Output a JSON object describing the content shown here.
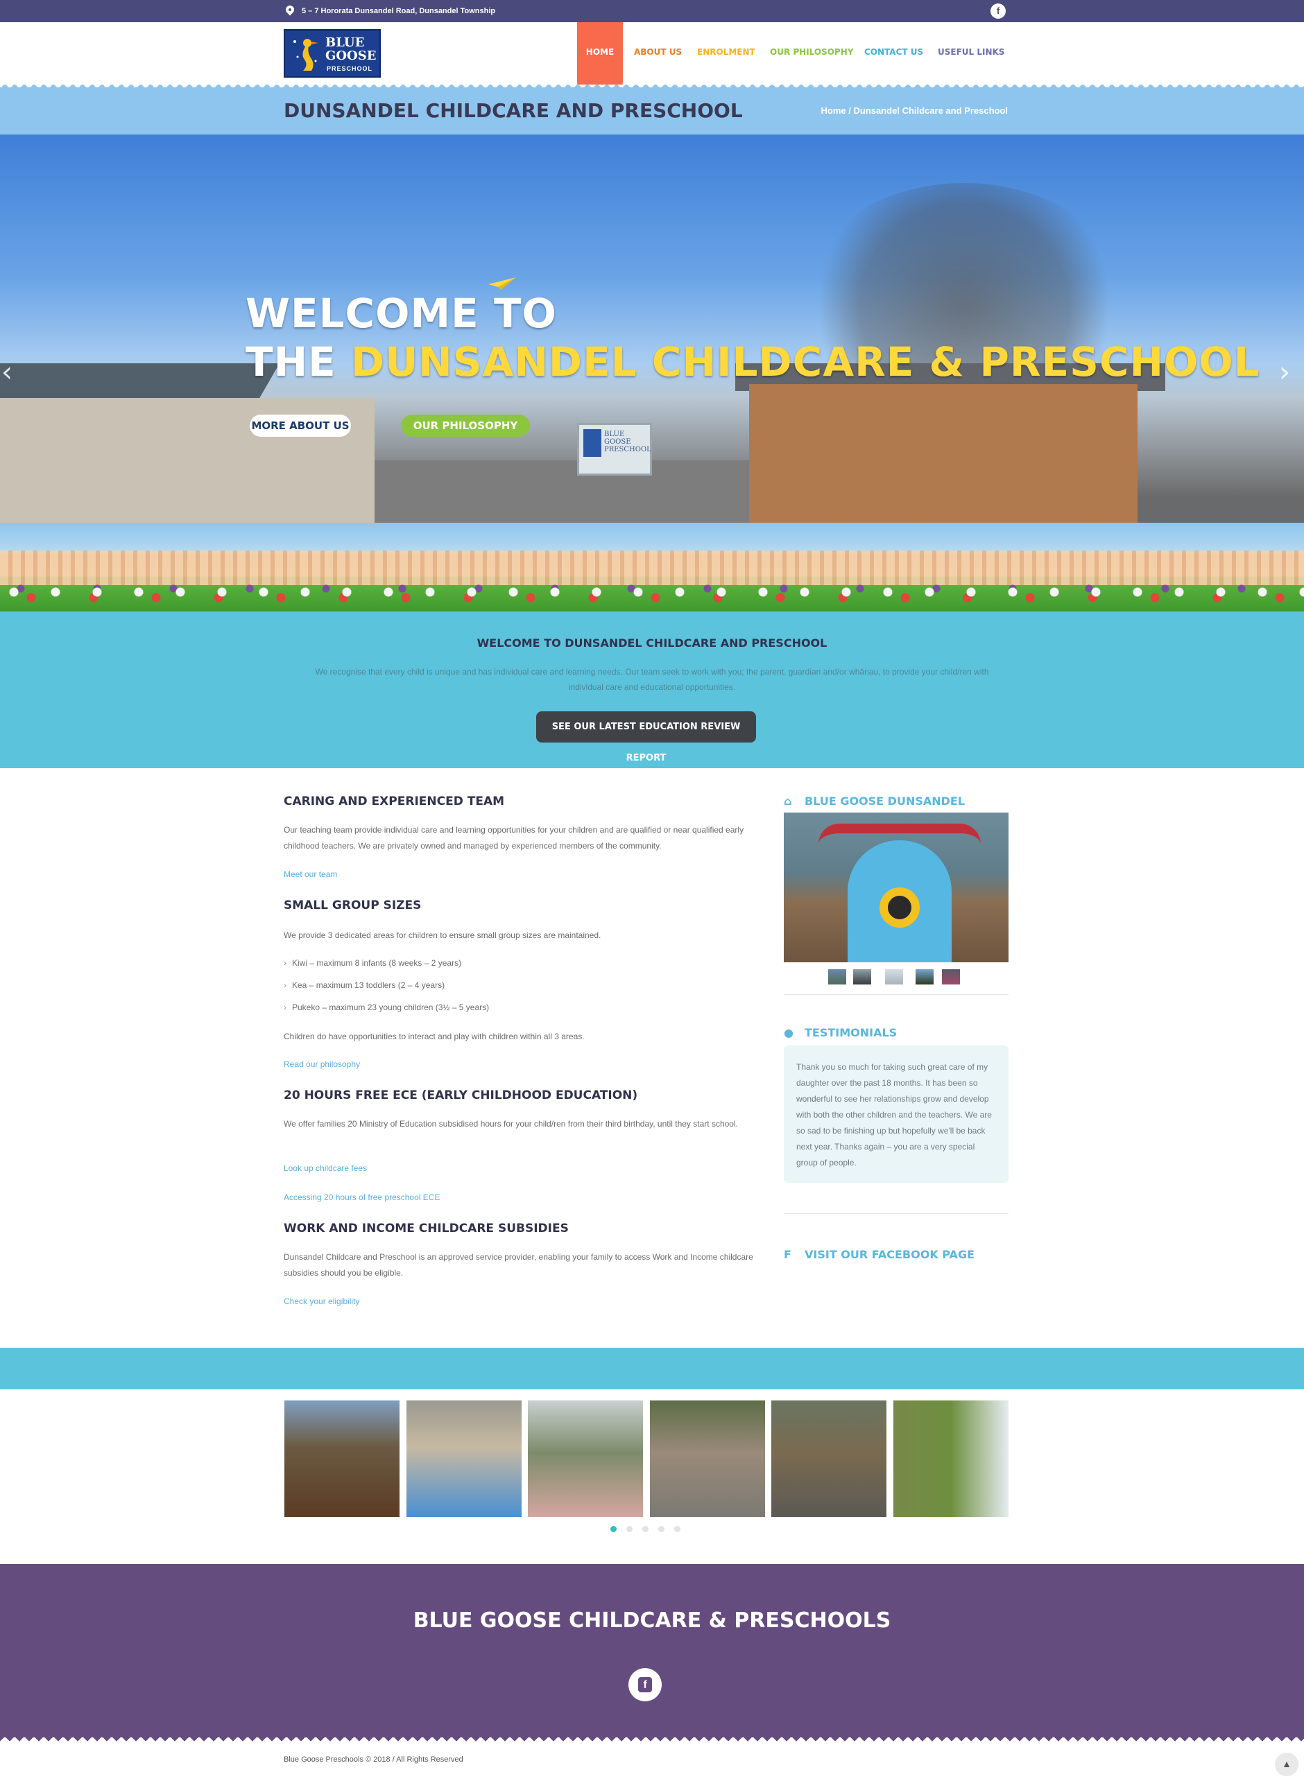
{
  "topbar": {
    "address": "5 – 7 Hororata Dunsandel Road, Dunsandel Township"
  },
  "header": {
    "logo_text": "BLUE GOOSE",
    "logo_sub": "PRESCHOOL",
    "nav": [
      {
        "label": "HOME",
        "color": "#ffffff"
      },
      {
        "label": "ABOUT US",
        "color": "#f07d1e"
      },
      {
        "label": "ENROLMENT",
        "color": "#f5b21b"
      },
      {
        "label": "OUR PHILOSOPHY",
        "color": "#8cc63e"
      },
      {
        "label": "CONTACT US",
        "color": "#3fb4d8"
      },
      {
        "label": "USEFUL LINKS",
        "color": "#6a6fb5"
      }
    ]
  },
  "titlebar": {
    "title": "DUNSANDEL CHILDCARE AND PRESCHOOL",
    "breadcrumb": "Home / Dunsandel Childcare and Preschool"
  },
  "hero": {
    "line1": "WELCOME TO",
    "line2_white": "THE",
    "line2_yellow": "DUNSANDEL CHILDCARE & PRESCHOOL",
    "btn_about": "MORE ABOUT US",
    "btn_philosophy": "OUR PHILOSOPHY",
    "sign_text": "BLUE GOOSE PRESCHOOL"
  },
  "welcome": {
    "heading": "WELCOME TO DUNSANDEL CHILDCARE AND PRESCHOOL",
    "text": "We recognise that every child is unique and has individual care and learning needs. Our team seek to work with you; the parent, guardian and/or whānau, to provide your child/ren with individual care and educational opportunities.",
    "button": "SEE OUR LATEST EDUCATION REVIEW REPORT"
  },
  "main": {
    "s1_title": "CARING AND EXPERIENCED TEAM",
    "s1_text": "Our teaching team provide individual care and learning opportunities for your children and are qualified or near qualified early childhood teachers. We are privately owned and managed by experienced members of the community.",
    "s1_link": "Meet our team",
    "s2_title": "SMALL GROUP SIZES",
    "s2_text": "We provide 3 dedicated areas for children to ensure small group sizes are maintained.",
    "s2_items": [
      "Kiwi – maximum 8 infants (8 weeks – 2 years)",
      "Kea – maximum 13 toddlers (2 – 4 years)",
      "Pukeko – maximum 23 young children (3½ – 5 years)"
    ],
    "s2_text2": "Children do have opportunities to interact and play with children within all 3 areas.",
    "s2_link": "Read our philosophy",
    "s3_title": "20 HOURS FREE ECE (EARLY CHILDHOOD EDUCATION)",
    "s3_text": "We offer families 20 Ministry of Education subsidised hours for your child/ren from their third birthday, until they start school.",
    "s3_link1": "Look up childcare fees",
    "s3_link2": "Accessing 20 hours of free preschool ECE",
    "s4_title": "WORK AND INCOME CHILDCARE SUBSIDIES",
    "s4_text": "Dunsandel Childcare and Preschool is an approved service provider, enabling your family to access Work and Income childcare subsidies should you be eligible.",
    "s4_link": "Check your eligibility"
  },
  "sidebar": {
    "gallery_title": "BLUE GOOSE DUNSANDEL",
    "testimonials_title": "TESTIMONIALS",
    "testimonial": "Thank you so much for taking such great care of my daughter over the past 18 months. It has been so wonderful to see her relationships grow and develop with both the other children and the teachers. We are so sad to be finishing up but hopefully we'll be back next year. Thanks again – you are a very special group of people.",
    "facebook_link": "VISIT OUR FACEBOOK PAGE"
  },
  "gallery": {
    "photo_count": 6,
    "dots": 5,
    "active_dot": 1
  },
  "footer": {
    "title": "BLUE GOOSE CHILDCARE & PRESCHOOLS",
    "copyright": "Blue Goose Preschools © 2018 / All Rights Reserved"
  },
  "colors": {
    "topbar": "#4a4a7c",
    "titlebar": "#8ec5ee",
    "welcome_band": "#5bc3dc",
    "footer": "#654c7f",
    "home_tab": "#f96a4c",
    "link": "#5aaee0"
  },
  "icons": [
    "map-pin-icon",
    "facebook-icon",
    "home-icon",
    "comments-icon",
    "arrow-up-icon",
    "chevron-left-icon",
    "chevron-right-icon"
  ]
}
